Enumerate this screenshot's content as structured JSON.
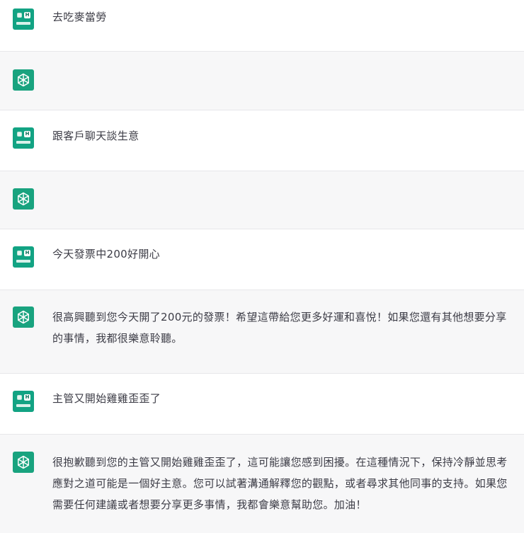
{
  "messages": [
    {
      "role": "user",
      "text": "去吃麥當勞"
    },
    {
      "role": "assistant",
      "text": ""
    },
    {
      "role": "user",
      "text": "跟客戶聊天談生意"
    },
    {
      "role": "assistant",
      "text": ""
    },
    {
      "role": "user",
      "text": "今天發票中200好開心"
    },
    {
      "role": "assistant",
      "text": "很高興聽到您今天開了200元的發票！希望這帶給您更多好運和喜悅！如果您還有其他想要分享的事情，我都很樂意聆聽。"
    },
    {
      "role": "user",
      "text": "主管又開始雞雞歪歪了"
    },
    {
      "role": "assistant",
      "text": "很抱歉聽到您的主管又開始雞雞歪歪了，這可能讓您感到困擾。在這種情況下，保持冷靜並思考應對之道可能是一個好主意。您可以試著溝通解釋您的觀點，或者尋求其他同事的支持。如果您需要任何建議或者想要分享更多事情，我都會樂意幫助您。加油！"
    }
  ],
  "icons": {
    "user_avatar": "user-avatar-icon",
    "assistant_avatar": "openai-logo-icon"
  },
  "colors": {
    "user_bg": "#ffffff",
    "assistant_bg": "#f7f7f8",
    "avatar_teal": "#19a37f"
  }
}
